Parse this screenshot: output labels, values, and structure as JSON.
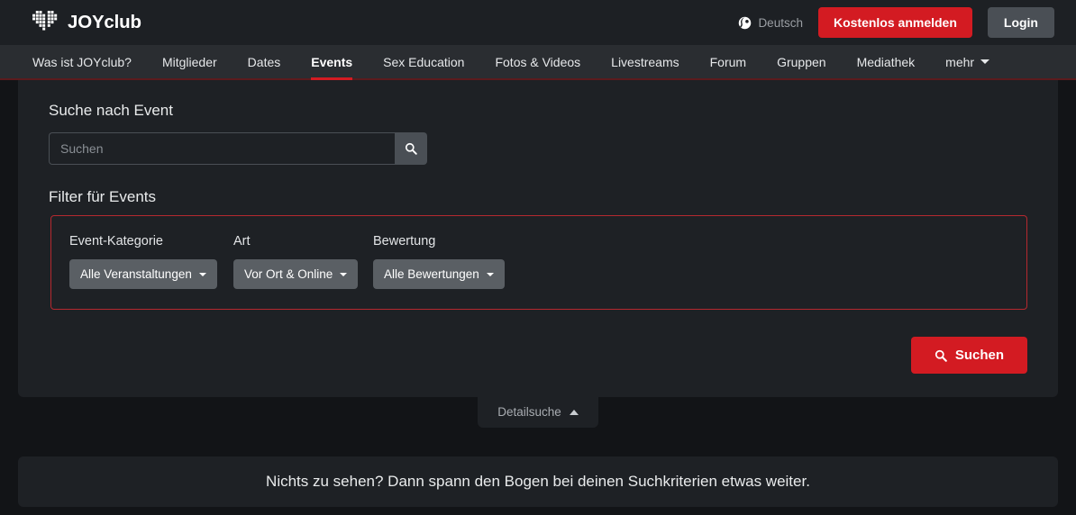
{
  "header": {
    "logo_text": "JOYclub",
    "logo_icon": "pixel-heart-icon",
    "language": "Deutsch",
    "language_icon": "globe-icon",
    "signup_label": "Kostenlos anmelden",
    "login_label": "Login",
    "accent_color": "#d31b22",
    "background_color": "#1d2024"
  },
  "nav": {
    "items": [
      {
        "label": "Was ist JOYclub?",
        "active": false
      },
      {
        "label": "Mitglieder",
        "active": false
      },
      {
        "label": "Dates",
        "active": false
      },
      {
        "label": "Events",
        "active": true
      },
      {
        "label": "Sex Education",
        "active": false
      },
      {
        "label": "Fotos & Videos",
        "active": false
      },
      {
        "label": "Livestreams",
        "active": false
      },
      {
        "label": "Forum",
        "active": false
      },
      {
        "label": "Gruppen",
        "active": false
      },
      {
        "label": "Mediathek",
        "active": false
      }
    ],
    "more_label": "mehr",
    "more_icon": "chevron-down-icon",
    "active_underline_color": "#d31b22"
  },
  "search": {
    "heading": "Suche nach Event",
    "placeholder": "Suchen",
    "value": "",
    "button_icon": "search-icon"
  },
  "filters": {
    "heading": "Filter für Events",
    "border_color": "#b5292f",
    "fields": [
      {
        "label": "Event-Kategorie",
        "value": "Alle Veranstaltungen",
        "icon": "caret-down-icon"
      },
      {
        "label": "Art",
        "value": "Vor Ort & Online",
        "icon": "caret-down-icon"
      },
      {
        "label": "Bewertung",
        "value": "Alle Bewertungen",
        "icon": "caret-down-icon"
      }
    ]
  },
  "submit": {
    "label": "Suchen",
    "icon": "search-icon",
    "color": "#d31b22"
  },
  "detail_toggle": {
    "label": "Detailsuche",
    "icon": "chevron-up-icon"
  },
  "empty_state": {
    "message": "Nichts zu sehen? Dann spann den Bogen bei deinen Suchkriterien etwas weiter."
  }
}
